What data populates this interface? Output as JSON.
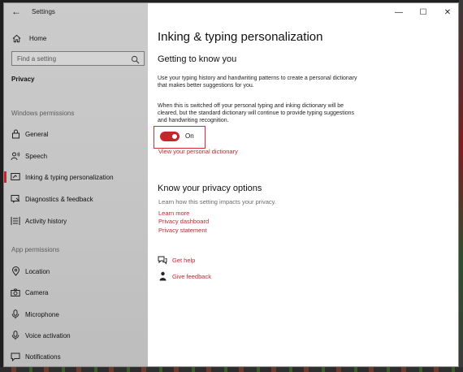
{
  "window": {
    "title": "Settings"
  },
  "controls": {
    "minimize": "—",
    "maximize": "☐",
    "close": "✕"
  },
  "sidebar": {
    "back_icon": "back-arrow-icon",
    "home_label": "Home",
    "search_placeholder": "Find a setting",
    "privacy_heading": "Privacy",
    "windows_permissions_heading": "Windows permissions",
    "app_permissions_heading": "App permissions",
    "windows_items": [
      {
        "label": "General",
        "icon": "lock-icon"
      },
      {
        "label": "Speech",
        "icon": "speech-icon"
      },
      {
        "label": "Inking & typing personalization",
        "icon": "inking-icon",
        "active": true
      },
      {
        "label": "Diagnostics & feedback",
        "icon": "diagnostics-icon"
      },
      {
        "label": "Activity history",
        "icon": "activity-history-icon"
      }
    ],
    "app_items": [
      {
        "label": "Location",
        "icon": "location-icon"
      },
      {
        "label": "Camera",
        "icon": "camera-icon"
      },
      {
        "label": "Microphone",
        "icon": "microphone-icon"
      },
      {
        "label": "Voice activation",
        "icon": "voice-activation-icon"
      },
      {
        "label": "Notifications",
        "icon": "notifications-icon"
      }
    ]
  },
  "main": {
    "title": "Inking & typing personalization",
    "getting_to_know_heading": "Getting to know you",
    "description": "Use your typing history and handwriting patterns to create a personal dictionary that makes better suggestions for you.",
    "switch_note": "When this is switched off your personal typing and inking dictionary will be cleared, but the standard dictionary will continue to provide typing suggestions and handwriting recognition.",
    "toggle_state": "On",
    "toggle_on": true,
    "view_dictionary_link": "View your personal dictionary",
    "privacy_options_heading": "Know your privacy options",
    "privacy_impact_text": "Learn how this setting impacts your privacy.",
    "links": [
      "Learn more",
      "Privacy dashboard",
      "Privacy statement"
    ],
    "help": {
      "get_help": "Get help",
      "give_feedback": "Give feedback"
    }
  },
  "colors": {
    "accent": "#c4262e",
    "sidebar_bg": "#c6c6c6"
  }
}
